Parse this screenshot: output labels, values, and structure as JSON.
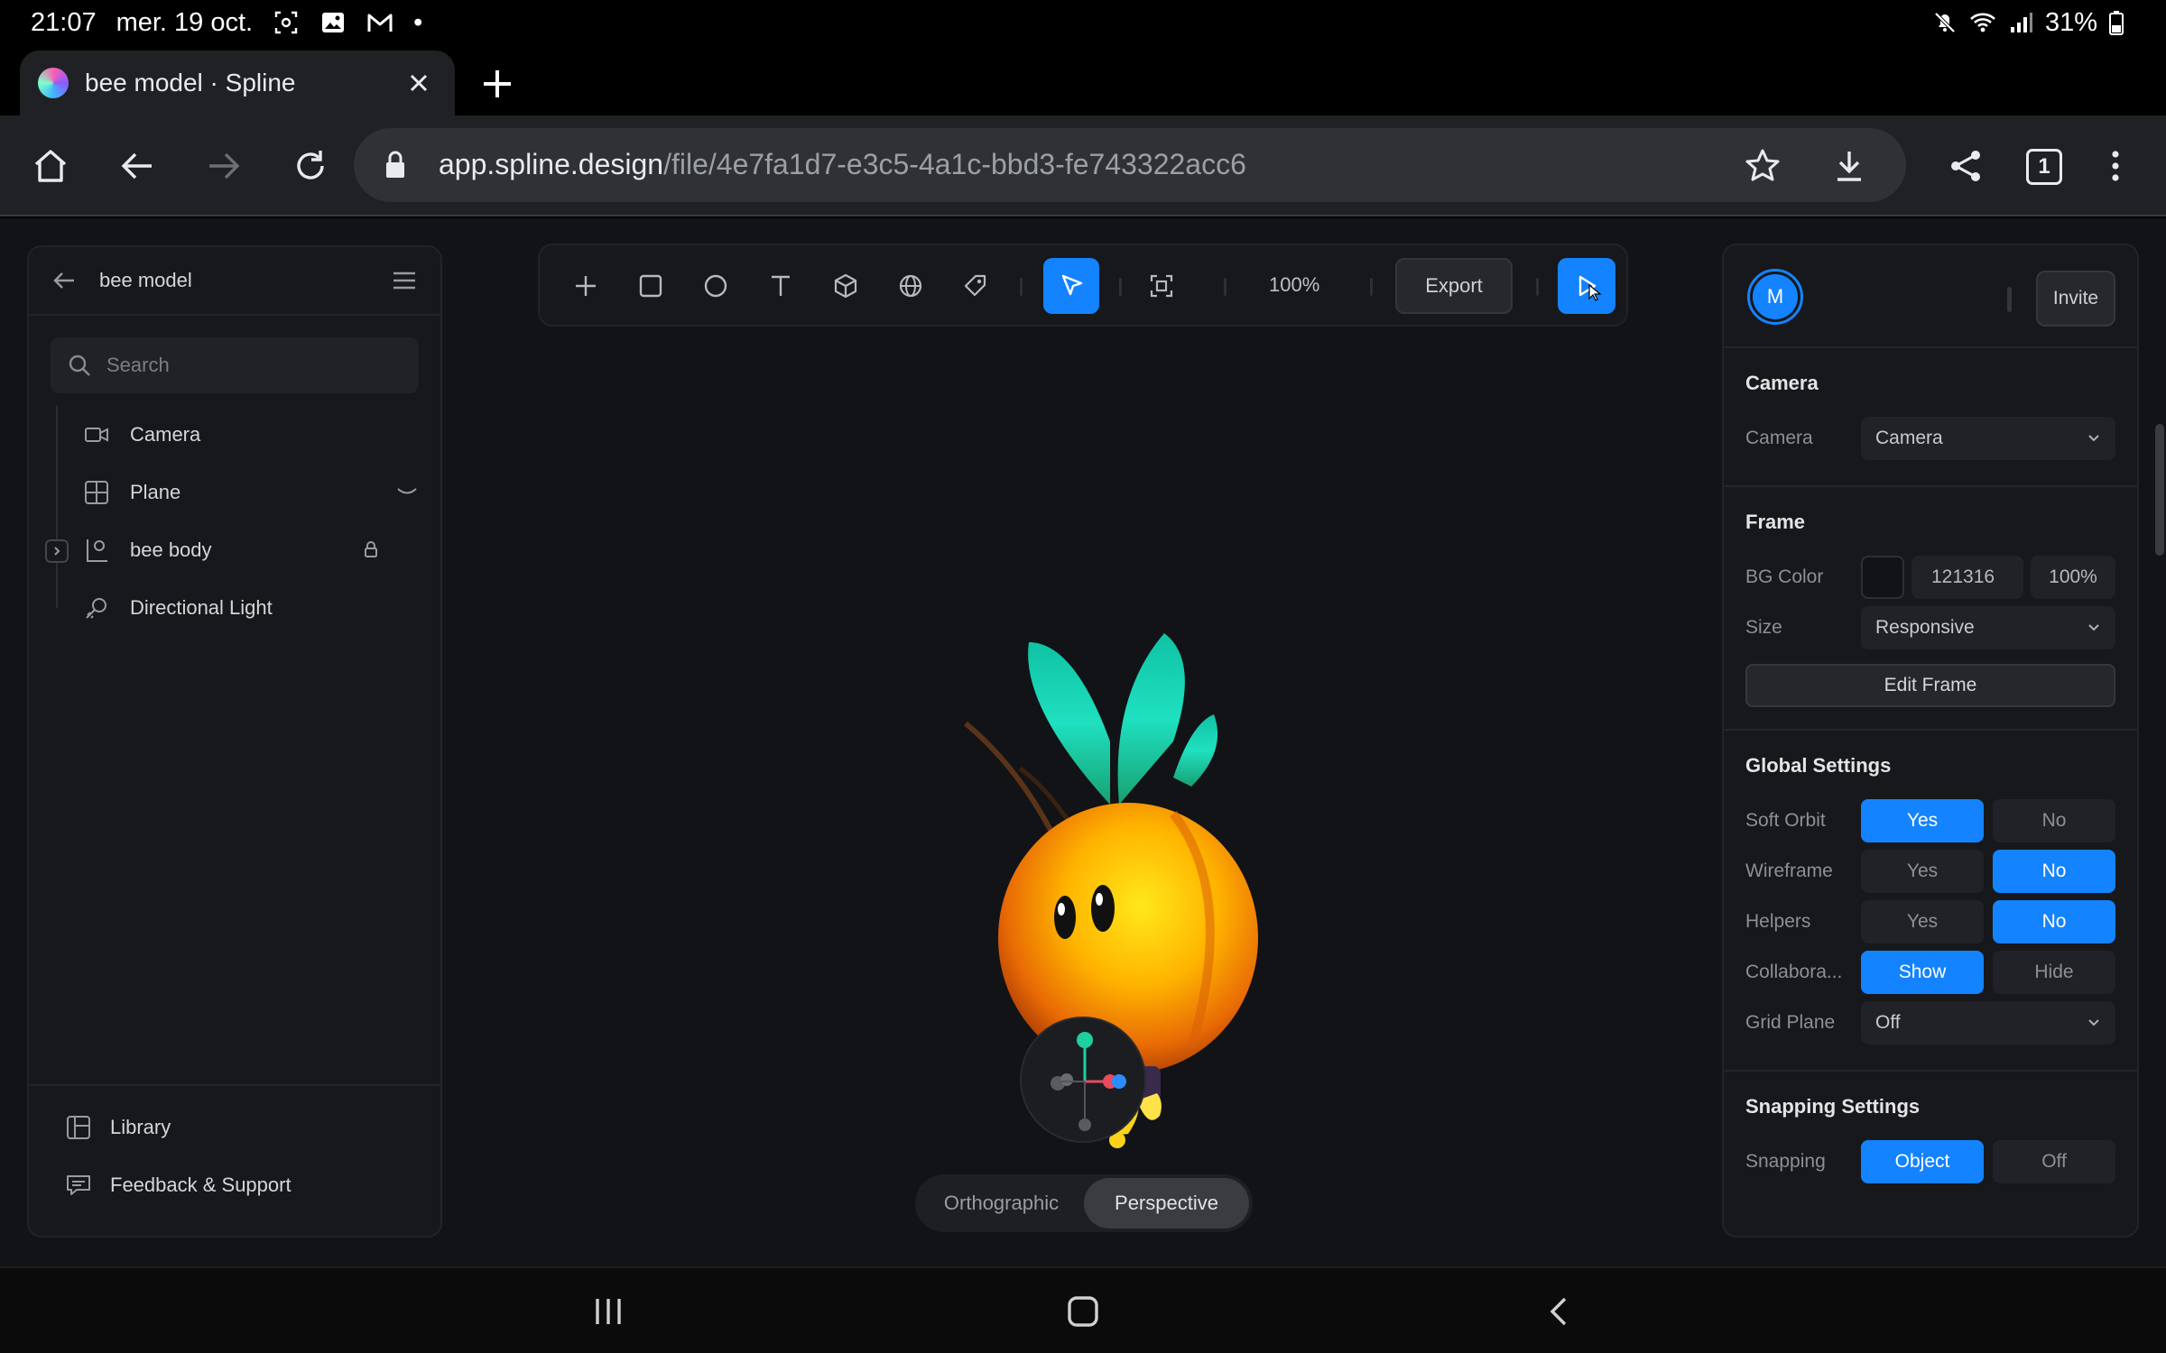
{
  "status_bar": {
    "time": "21:07",
    "date": "mer. 19 oct.",
    "dot": "•",
    "battery": "31%"
  },
  "browser": {
    "tab_title": "bee model · Spline",
    "url_host": "app.spline.design",
    "url_path": "/file/4e7fa1d7-e3c5-4a1c-bbd3-fe743322acc6",
    "tab_count": "1"
  },
  "left_panel": {
    "file_name": "bee model",
    "search_placeholder": "Search",
    "tree": [
      {
        "label": "Camera",
        "icon": "camera-icon"
      },
      {
        "label": "Plane",
        "icon": "grid-icon"
      },
      {
        "label": "bee body",
        "icon": "group-icon"
      },
      {
        "label": "Directional Light",
        "icon": "light-icon"
      }
    ],
    "footer": [
      {
        "label": "Library",
        "icon": "library-icon"
      },
      {
        "label": "Feedback & Support",
        "icon": "chat-icon"
      }
    ]
  },
  "toolbar": {
    "zoom": "100%",
    "export_label": "Export"
  },
  "viewport": {
    "orthographic": "Orthographic",
    "perspective": "Perspective"
  },
  "right_panel": {
    "avatar_letter": "M",
    "invite_label": "Invite",
    "camera": {
      "heading": "Camera",
      "label": "Camera",
      "value": "Camera"
    },
    "frame": {
      "heading": "Frame",
      "bg_label": "BG Color",
      "bg_hex": "121316",
      "bg_opacity": "100%",
      "size_label": "Size",
      "size_value": "Responsive",
      "edit_frame": "Edit Frame"
    },
    "global": {
      "heading": "Global Settings",
      "soft_orbit": "Soft Orbit",
      "wireframe": "Wireframe",
      "helpers": "Helpers",
      "collaborators": "Collabora...",
      "grid_plane": "Grid Plane",
      "grid_plane_value": "Off",
      "yes": "Yes",
      "no": "No",
      "show": "Show",
      "hide": "Hide"
    },
    "snapping": {
      "heading": "Snapping Settings",
      "label": "Snapping",
      "object": "Object",
      "off": "Off"
    }
  },
  "colors": {
    "accent": "#1483ff",
    "background": "#121316",
    "panel": "#17181c"
  }
}
